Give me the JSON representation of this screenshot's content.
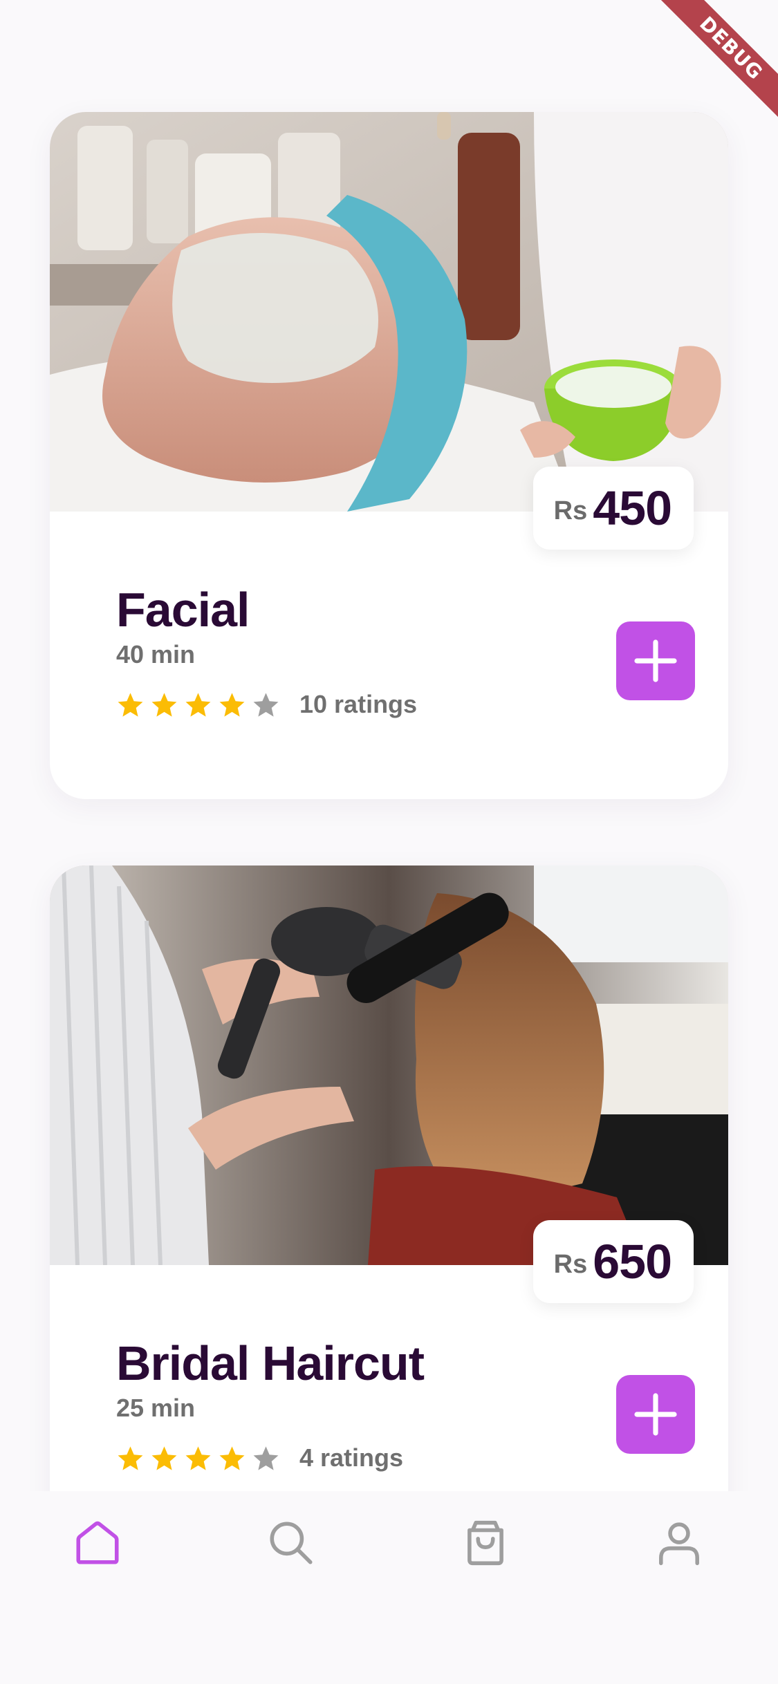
{
  "debug_banner": "DEBUG",
  "colors": {
    "accent": "#c151e6",
    "title": "#2a0a35",
    "muted": "#6f6f6f",
    "star_filled": "#fbbc05",
    "star_empty": "#9e9e9e",
    "nav_inactive": "#9e9e9e"
  },
  "services": [
    {
      "title": "Facial",
      "duration": "40 min",
      "price_currency": "Rs",
      "price_value": "450",
      "rating_stars": 4,
      "rating_max": 5,
      "ratings_text": "10 ratings",
      "image": "facial-treatment-photo"
    },
    {
      "title": "Bridal Haircut",
      "duration": "25 min",
      "price_currency": "Rs",
      "price_value": "650",
      "rating_stars": 4,
      "rating_max": 5,
      "ratings_text": "4 ratings",
      "image": "hair-styling-photo"
    }
  ],
  "bottom_nav": [
    {
      "icon": "home-icon",
      "active": true
    },
    {
      "icon": "search-icon",
      "active": false
    },
    {
      "icon": "shopping-bag-icon",
      "active": false
    },
    {
      "icon": "profile-icon",
      "active": false
    }
  ]
}
